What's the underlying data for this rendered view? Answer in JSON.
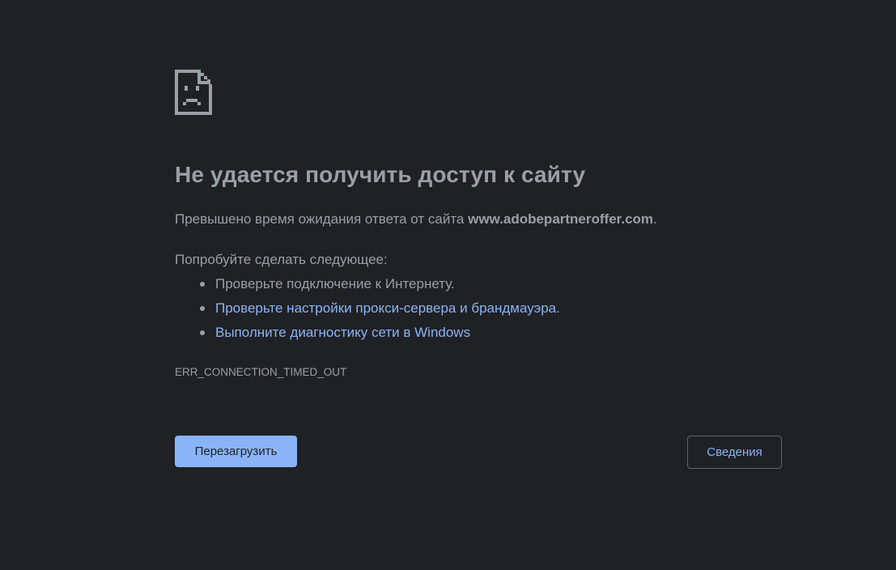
{
  "icon": {
    "name": "sad-page-icon",
    "color": "#9aa0a6"
  },
  "title": "Не удается получить доступ к сайту",
  "summary": {
    "prefix": "Превышено время ожидания ответа от сайта ",
    "host": "www.adobepartneroffer.com",
    "suffix": "."
  },
  "suggestions": {
    "heading": "Попробуйте сделать следующее:",
    "items": [
      {
        "text": "Проверьте подключение к Интернету.",
        "is_link": false
      },
      {
        "text": "Проверьте настройки прокси-сервера и брандмауэра",
        "suffix": ".",
        "is_link": true
      },
      {
        "text": "Выполните диагностику сети в Windows",
        "is_link": true
      }
    ]
  },
  "error_code": "ERR_CONNECTION_TIMED_OUT",
  "buttons": {
    "reload": "Перезагрузить",
    "details": "Сведения"
  },
  "colors": {
    "background": "#202124",
    "text": "#9aa0a6",
    "link": "#8ab4f8",
    "primary_button": "#8ab4f8",
    "border": "#5f6368"
  }
}
